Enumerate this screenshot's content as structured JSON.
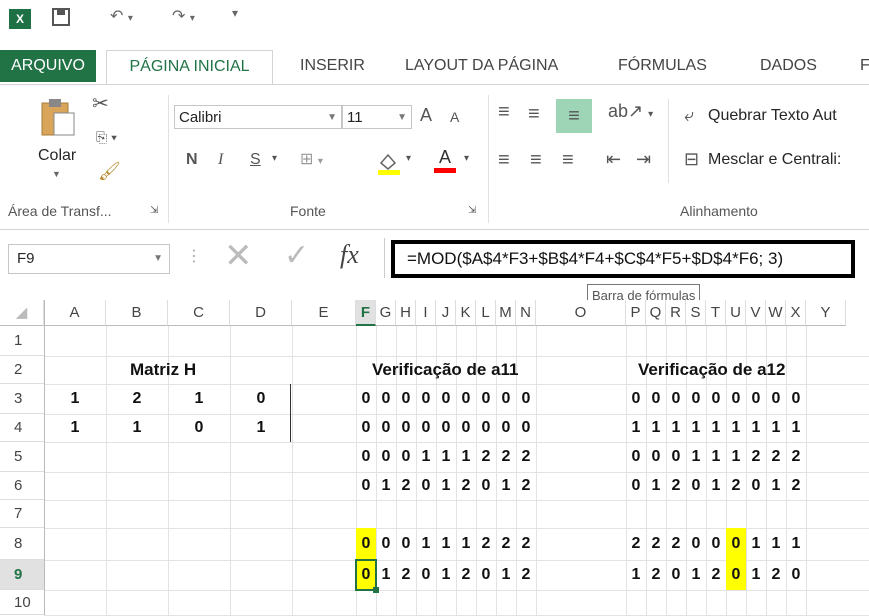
{
  "quick_access": {
    "logo": "X",
    "save_icon": "save-icon",
    "undo_icon": "undo-icon",
    "redo_icon": "redo-icon"
  },
  "tabs": [
    "ARQUIVO",
    "PÁGINA INICIAL",
    "INSERIR",
    "LAYOUT DA PÁGINA",
    "FÓRMULAS",
    "DADOS",
    "F"
  ],
  "ribbon": {
    "paste_label": "Colar",
    "clipboard_group": "Área de Transf...",
    "font_name": "Calibri",
    "font_size": "11",
    "grow_font": "A",
    "shrink_font": "A",
    "bold": "N",
    "italic": "I",
    "underline": "S",
    "font_color": "A",
    "font_group": "Fonte",
    "wrap_text": "Quebrar Texto Aut",
    "merge_center": "Mesclar e Centrali:",
    "align_group": "Alinhamento"
  },
  "formula_bar": {
    "name_box": "F9",
    "fx": "fx",
    "formula": "=MOD($A$4*F3+$B$4*F4+$C$4*F5+$D$4*F6; 3)",
    "tooltip": "Barra de fórmulas"
  },
  "columns": [
    "A",
    "B",
    "C",
    "D",
    "E",
    "F",
    "G",
    "H",
    "I",
    "J",
    "K",
    "L",
    "M",
    "N",
    "O",
    "P",
    "Q",
    "R",
    "S",
    "T",
    "U",
    "V",
    "W",
    "X",
    "Y"
  ],
  "rows": [
    "1",
    "2",
    "3",
    "4",
    "5",
    "6",
    "7",
    "8",
    "9",
    "10"
  ],
  "matrix_title": "Matriz H",
  "verif_a11_title": "Verificação de a11",
  "verif_a12_title": "Verificação de a12",
  "matrix": [
    [
      "1",
      "2",
      "1",
      "0"
    ],
    [
      "1",
      "1",
      "0",
      "1"
    ]
  ],
  "a11": [
    [
      "0",
      "0",
      "0",
      "0",
      "0",
      "0",
      "0",
      "0",
      "0"
    ],
    [
      "0",
      "0",
      "0",
      "0",
      "0",
      "0",
      "0",
      "0",
      "0"
    ],
    [
      "0",
      "0",
      "0",
      "1",
      "1",
      "1",
      "2",
      "2",
      "2"
    ],
    [
      "0",
      "1",
      "2",
      "0",
      "1",
      "2",
      "0",
      "1",
      "2"
    ],
    [
      "0",
      "0",
      "0",
      "1",
      "1",
      "1",
      "2",
      "2",
      "2"
    ],
    [
      "0",
      "1",
      "2",
      "0",
      "1",
      "2",
      "0",
      "1",
      "2"
    ]
  ],
  "a12": [
    [
      "0",
      "0",
      "0",
      "0",
      "0",
      "0",
      "0",
      "0",
      "0"
    ],
    [
      "1",
      "1",
      "1",
      "1",
      "1",
      "1",
      "1",
      "1",
      "1"
    ],
    [
      "0",
      "0",
      "0",
      "1",
      "1",
      "1",
      "2",
      "2",
      "2"
    ],
    [
      "0",
      "1",
      "2",
      "0",
      "1",
      "2",
      "0",
      "1",
      "2"
    ],
    [
      "2",
      "2",
      "2",
      "0",
      "0",
      "0",
      "1",
      "1",
      "1"
    ],
    [
      "1",
      "2",
      "0",
      "1",
      "2",
      "0",
      "1",
      "2",
      "0"
    ]
  ],
  "colors": {
    "excel_green": "#217346",
    "highlight": "#ffff00"
  }
}
